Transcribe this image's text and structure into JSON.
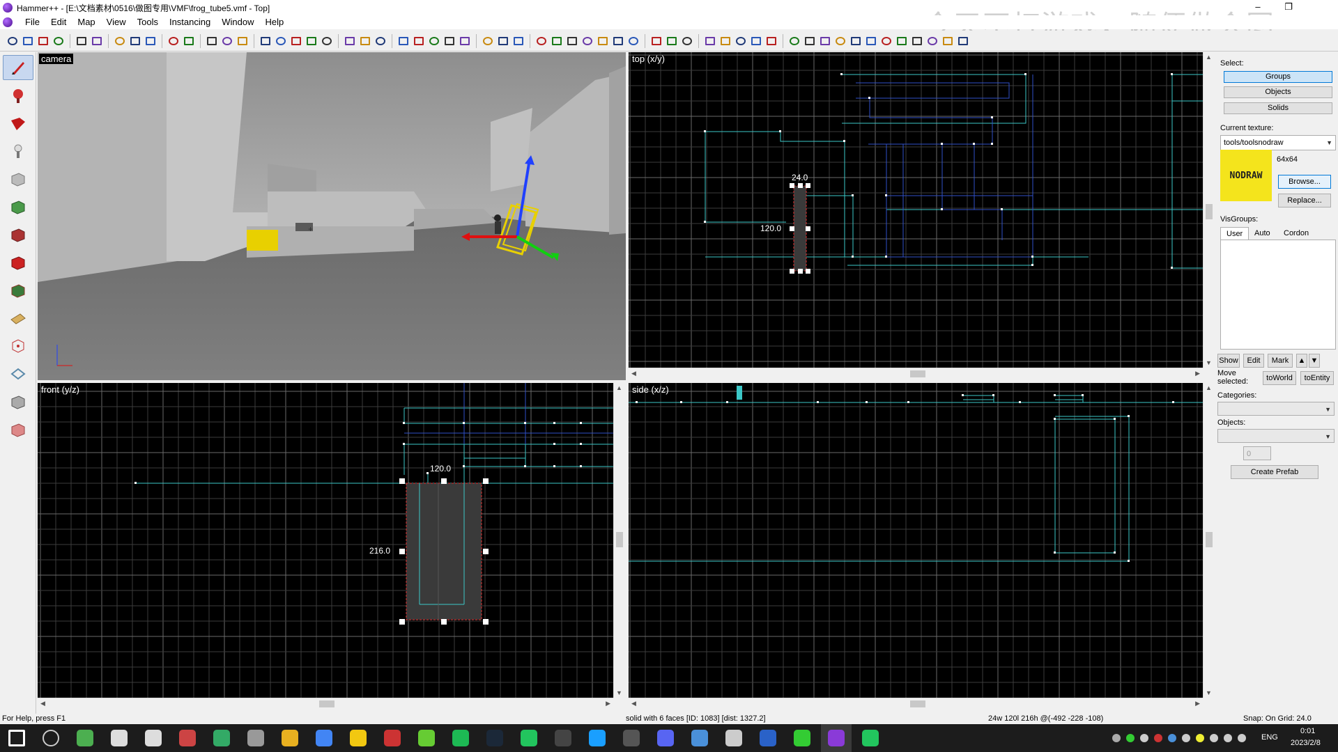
{
  "window": {
    "title": "Hammer++ - [E:\\文档素材\\0516\\做图专用\\VMF\\frog_tube5.vmf - Top]",
    "watermark": "今天不打游戏，随便做会图"
  },
  "menu": [
    "File",
    "Edit",
    "Map",
    "View",
    "Tools",
    "Instancing",
    "Window",
    "Help"
  ],
  "viewports": {
    "camera": "camera",
    "top": "top (x/y)",
    "front": "front (y/z)",
    "side": "side (x/z)"
  },
  "dimensions": {
    "top_width": "24.0",
    "top_height": "120.0",
    "front_width": "120.0",
    "front_height": "216.0"
  },
  "panel": {
    "select_label": "Select:",
    "select_buttons": [
      "Groups",
      "Objects",
      "Solids"
    ],
    "current_texture_label": "Current texture:",
    "texture_value": "tools/toolsnodraw",
    "texture_size": "64x64",
    "texture_preview_text": "NODRAW",
    "browse": "Browse...",
    "replace": "Replace...",
    "visgroups_label": "VisGroups:",
    "vis_tabs": [
      "User",
      "Auto",
      "Cordon"
    ],
    "vis_buttons": [
      "Show",
      "Edit",
      "Mark"
    ],
    "move_selected_label": "Move selected:",
    "to_world": "toWorld",
    "to_entity": "toEntity",
    "categories_label": "Categories:",
    "objects_label": "Objects:",
    "objects_count": "0",
    "create_prefab": "Create Prefab"
  },
  "status": {
    "help": "For Help, press F1",
    "selection": "solid with 6 faces  [ID: 1083]  [dist: 1327.2]",
    "size": "24w 120l 216h @(-492 -228 -108)",
    "snap": "Snap: On Grid: 24.0"
  },
  "taskbar": {
    "lang": "ENG",
    "time": "0:01",
    "date": "2023/2/8"
  },
  "colors": {
    "grid_minor": "#3c3c3c",
    "grid_major": "#6a6a6a",
    "brush_line": "#3cc8c8",
    "brush_blue": "#3050c8",
    "selection": "#ff3030",
    "accent": "#0078d7"
  }
}
